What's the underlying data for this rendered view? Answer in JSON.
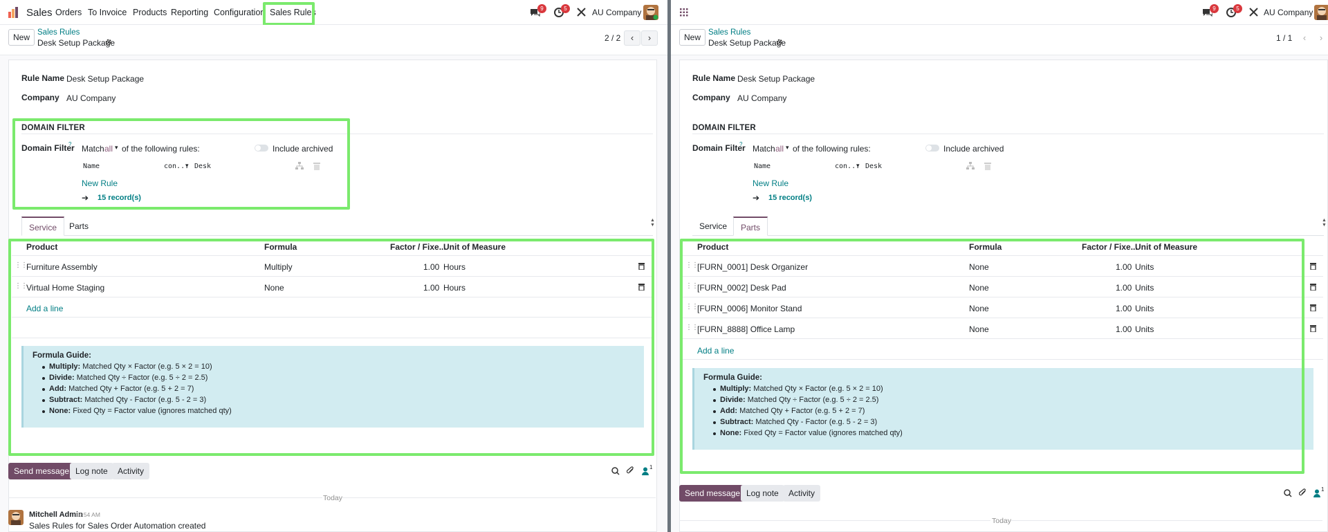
{
  "left": {
    "topbar": {
      "app_name": "Sales",
      "menu": [
        "Orders",
        "To Invoice",
        "Products",
        "Reporting",
        "Configuration",
        "Sales Rules"
      ],
      "chat_count": "9",
      "activity_count": "5",
      "company": "AU Company"
    },
    "control": {
      "new_label": "New",
      "breadcrumb_parent": "Sales Rules",
      "breadcrumb_current": "Desk Setup Package",
      "pager": "2 / 2"
    },
    "form": {
      "rule_name_label": "Rule Name",
      "rule_name_value": "Desk Setup Package",
      "company_label": "Company",
      "company_value": "AU Company",
      "section_title": "DOMAIN FILTER",
      "domain_label": "Domain Filter",
      "domain_help": "?",
      "match_prefix": "Match",
      "match_mode": "all",
      "match_suffix": "of the following rules:",
      "include_archived": "Include archived",
      "rule_field": "Name",
      "rule_operator": "con...",
      "rule_value": "Desk",
      "new_rule": "New Rule",
      "records": "15 record(s)"
    },
    "tabs": [
      "Service",
      "Parts"
    ],
    "table": {
      "headers": [
        "Product",
        "Formula",
        "Factor / Fixe...",
        "Unit of Measure"
      ],
      "rows": [
        {
          "product": "Furniture Assembly",
          "formula": "Multiply",
          "factor": "1.00",
          "uom": "Hours"
        },
        {
          "product": "Virtual Home Staging",
          "formula": "None",
          "factor": "1.00",
          "uom": "Hours"
        }
      ],
      "add_line": "Add a line"
    },
    "guide": {
      "title": "Formula Guide:",
      "items": [
        {
          "term": "Multiply:",
          "text": "Matched Qty × Factor (e.g. 5 × 2 = 10)"
        },
        {
          "term": "Divide:",
          "text": "Matched Qty ÷ Factor (e.g. 5 ÷ 2 = 2.5)"
        },
        {
          "term": "Add:",
          "text": "Matched Qty + Factor (e.g. 5 + 2 = 7)"
        },
        {
          "term": "Subtract:",
          "text": "Matched Qty - Factor (e.g. 5 - 2 = 3)"
        },
        {
          "term": "None:",
          "text": "Fixed Qty = Factor value (ignores matched qty)"
        }
      ]
    },
    "chatter": {
      "send_message": "Send message",
      "log_note": "Log note",
      "activity": "Activity",
      "followers": "1",
      "today": "Today",
      "author": "Mitchell Admin",
      "time": "10:54 AM",
      "message": "Sales Rules for Sales Order Automation created"
    }
  },
  "right": {
    "topbar": {
      "chat_count": "9",
      "activity_count": "5",
      "company": "AU Company"
    },
    "control": {
      "new_label": "New",
      "breadcrumb_parent": "Sales Rules",
      "breadcrumb_current": "Desk Setup Package",
      "pager": "1 / 1"
    },
    "form": {
      "rule_name_label": "Rule Name",
      "rule_name_value": "Desk Setup Package",
      "company_label": "Company",
      "company_value": "AU Company",
      "section_title": "DOMAIN FILTER",
      "domain_label": "Domain Filter",
      "domain_help": "?",
      "match_prefix": "Match",
      "match_mode": "all",
      "match_suffix": "of the following rules:",
      "include_archived": "Include archived",
      "rule_field": "Name",
      "rule_operator": "con...",
      "rule_value": "Desk",
      "new_rule": "New Rule",
      "records": "15 record(s)"
    },
    "tabs": [
      "Service",
      "Parts"
    ],
    "table": {
      "headers": [
        "Product",
        "Formula",
        "Factor / Fixe...",
        "Unit of Measure"
      ],
      "rows": [
        {
          "product": "[FURN_0001] Desk Organizer",
          "formula": "None",
          "factor": "1.00",
          "uom": "Units"
        },
        {
          "product": "[FURN_0002] Desk Pad",
          "formula": "None",
          "factor": "1.00",
          "uom": "Units"
        },
        {
          "product": "[FURN_0006] Monitor Stand",
          "formula": "None",
          "factor": "1.00",
          "uom": "Units"
        },
        {
          "product": "[FURN_8888] Office Lamp",
          "formula": "None",
          "factor": "1.00",
          "uom": "Units"
        }
      ],
      "add_line": "Add a line"
    },
    "guide": {
      "title": "Formula Guide:",
      "items": [
        {
          "term": "Multiply:",
          "text": "Matched Qty × Factor (e.g. 5 × 2 = 10)"
        },
        {
          "term": "Divide:",
          "text": "Matched Qty ÷ Factor (e.g. 5 ÷ 2 = 2.5)"
        },
        {
          "term": "Add:",
          "text": "Matched Qty + Factor (e.g. 5 + 2 = 7)"
        },
        {
          "term": "Subtract:",
          "text": "Matched Qty - Factor (e.g. 5 - 2 = 3)"
        },
        {
          "term": "None:",
          "text": "Fixed Qty = Factor value (ignores matched qty)"
        }
      ]
    },
    "chatter": {
      "send_message": "Send message",
      "log_note": "Log note",
      "activity": "Activity",
      "followers": "1",
      "today": "Today"
    }
  },
  "colors": {
    "primary": "#714b67",
    "link": "#017e84",
    "highlight": "#7bea6d",
    "guide_bg": "#d2ecf1",
    "badge": "#d9383d"
  }
}
